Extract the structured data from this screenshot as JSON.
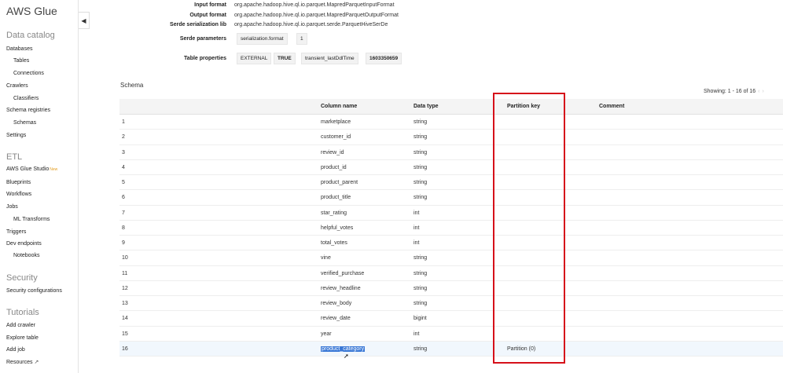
{
  "sidebar": {
    "title": "AWS Glue",
    "collapse_glyph": "◀",
    "sections": {
      "data_catalog": "Data catalog",
      "etl": "ETL",
      "security": "Security",
      "tutorials": "Tutorials"
    },
    "items": {
      "databases": "Databases",
      "tables": "Tables",
      "connections": "Connections",
      "crawlers": "Crawlers",
      "classifiers": "Classifiers",
      "schema_registries": "Schema registries",
      "schemas": "Schemas",
      "settings": "Settings",
      "glue_studio": "AWS Glue Studio",
      "glue_studio_badge": "New",
      "blueprints": "Blueprints",
      "workflows": "Workflows",
      "jobs": "Jobs",
      "ml_transforms": "ML Transforms",
      "triggers": "Triggers",
      "dev_endpoints": "Dev endpoints",
      "notebooks": "Notebooks",
      "security_configurations": "Security configurations",
      "add_crawler": "Add crawler",
      "explore_table": "Explore table",
      "add_job": "Add job",
      "resources": "Resources"
    }
  },
  "properties": {
    "input_format_label": "Input format",
    "input_format_value": "org.apache.hadoop.hive.ql.io.parquet.MapredParquetInputFormat",
    "output_format_label": "Output format",
    "output_format_value": "org.apache.hadoop.hive.ql.io.parquet.MapredParquetOutputFormat",
    "serde_lib_label": "Serde serialization lib",
    "serde_lib_value": "org.apache.hadoop.hive.ql.io.parquet.serde.ParquetHiveSerDe",
    "serde_params_label": "Serde parameters",
    "serde_params_key": "serialization.format",
    "serde_params_value": "1",
    "table_props_label": "Table properties",
    "table_props": [
      "EXTERNAL",
      "TRUE",
      "transient_lastDdlTime",
      "1603350659"
    ]
  },
  "schema": {
    "title": "Schema",
    "showing": "Showing: 1 - 16 of 16",
    "pager_prev": "‹",
    "pager_next": "›",
    "columns": {
      "num": "",
      "name": "Column name",
      "type": "Data type",
      "partition": "Partition key",
      "comment": "Comment"
    },
    "rows": [
      {
        "num": "1",
        "name": "marketplace",
        "type": "string",
        "partition": "",
        "comment": ""
      },
      {
        "num": "2",
        "name": "customer_id",
        "type": "string",
        "partition": "",
        "comment": ""
      },
      {
        "num": "3",
        "name": "review_id",
        "type": "string",
        "partition": "",
        "comment": ""
      },
      {
        "num": "4",
        "name": "product_id",
        "type": "string",
        "partition": "",
        "comment": ""
      },
      {
        "num": "5",
        "name": "product_parent",
        "type": "string",
        "partition": "",
        "comment": ""
      },
      {
        "num": "6",
        "name": "product_title",
        "type": "string",
        "partition": "",
        "comment": ""
      },
      {
        "num": "7",
        "name": "star_rating",
        "type": "int",
        "partition": "",
        "comment": ""
      },
      {
        "num": "8",
        "name": "helpful_votes",
        "type": "int",
        "partition": "",
        "comment": ""
      },
      {
        "num": "9",
        "name": "total_votes",
        "type": "int",
        "partition": "",
        "comment": ""
      },
      {
        "num": "10",
        "name": "vine",
        "type": "string",
        "partition": "",
        "comment": ""
      },
      {
        "num": "11",
        "name": "verified_purchase",
        "type": "string",
        "partition": "",
        "comment": ""
      },
      {
        "num": "12",
        "name": "review_headline",
        "type": "string",
        "partition": "",
        "comment": ""
      },
      {
        "num": "13",
        "name": "review_body",
        "type": "string",
        "partition": "",
        "comment": ""
      },
      {
        "num": "14",
        "name": "review_date",
        "type": "bigint",
        "partition": "",
        "comment": ""
      },
      {
        "num": "15",
        "name": "year",
        "type": "int",
        "partition": "",
        "comment": ""
      },
      {
        "num": "16",
        "name": "product_category",
        "type": "string",
        "partition": "Partition (0)",
        "comment": ""
      }
    ]
  },
  "colors": {
    "annotation_box": "#d6101a",
    "selection": "#3a78d6"
  }
}
